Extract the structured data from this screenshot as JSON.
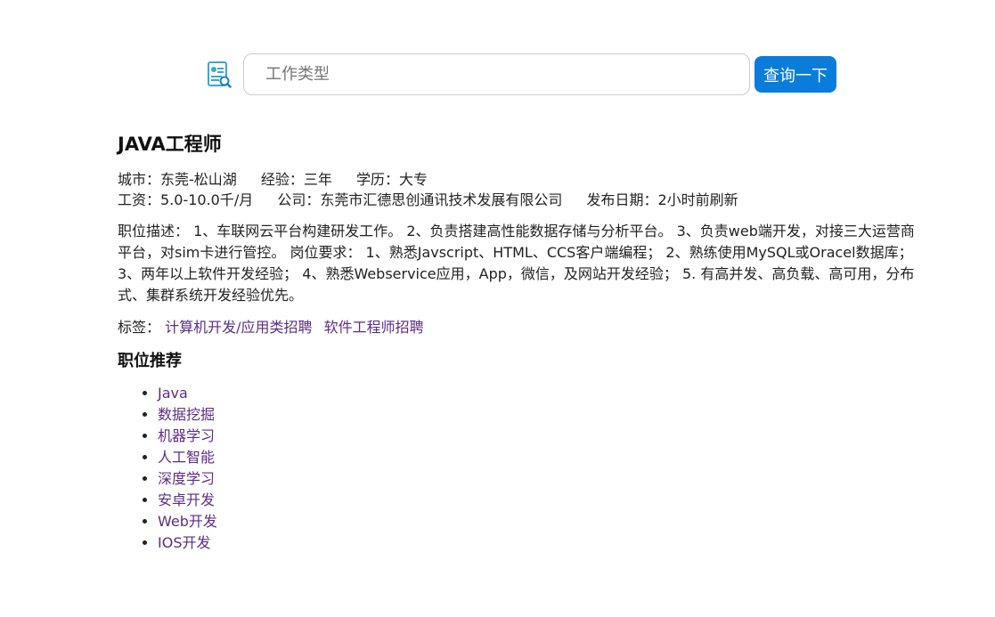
{
  "search": {
    "icon": "resume-search-icon",
    "placeholder": "工作类型",
    "value": "",
    "button_label": "查询一下",
    "button_color": "#0a7ddc"
  },
  "job": {
    "title": "JAVA工程师",
    "city": "城市：东莞-松山湖",
    "experience": "经验：三年",
    "education": "学历：大专",
    "salary": "工资：5.0-10.0千/月",
    "company": "公司：东莞市汇德思创通讯技术发展有限公司",
    "posted": "发布日期：2小时前刷新",
    "description": "职位描述： 1、车联网云平台构建研发工作。 2、负责搭建高性能数据存储与分析平台。 3、负责web端开发，对接三大运营商平台，对sim卡进行管控。 岗位要求： 1、熟悉Javscript、HTML、CCS客户端编程； 2、熟练使用MySQL或Oracel数据库； 3、两年以上软件开发经验； 4、熟悉Webservice应用，App，微信，及网站开发经验； 5. 有高并发、高负载、高可用，分布式、集群系统开发经验优先。",
    "tags_label": "标签：",
    "tags": [
      "计算机开发/应用类招聘",
      "软件工程师招聘"
    ],
    "link_color": "#5b2d86"
  },
  "recommend": {
    "title": "职位推荐",
    "items": [
      "Java",
      "数据挖掘",
      "机器学习",
      "人工智能",
      "深度学习",
      "安卓开发",
      "Web开发",
      "IOS开发"
    ]
  }
}
